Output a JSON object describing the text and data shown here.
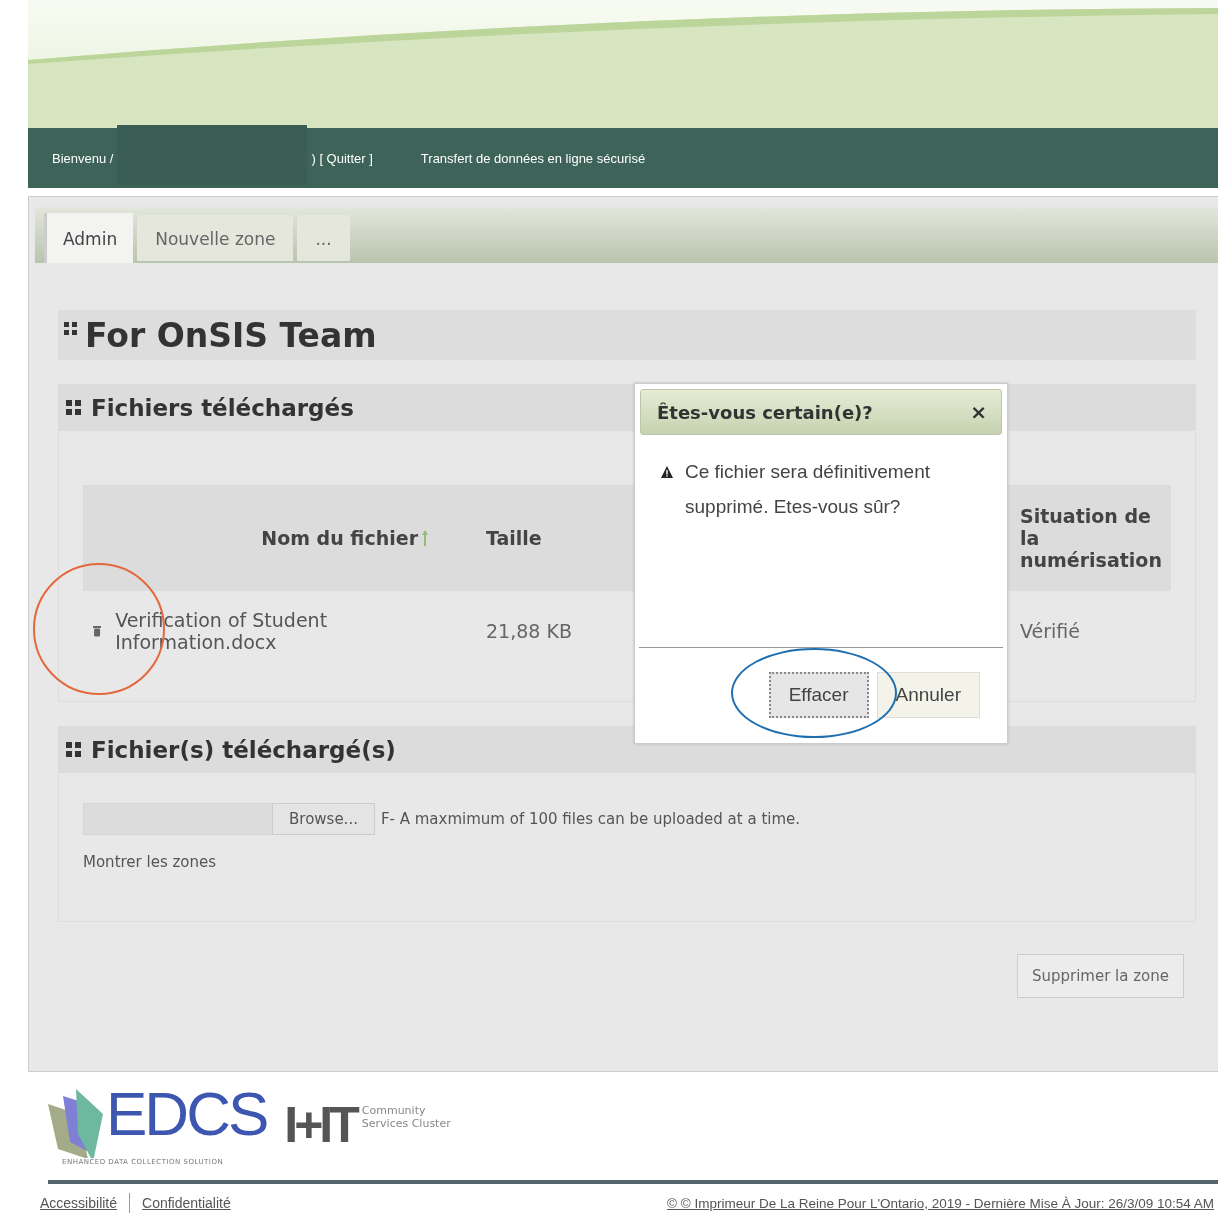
{
  "header": {
    "welcome": "Bienvenu /",
    "quit": ") [ Quitter ]",
    "title": "Transfert de données en ligne sécurisé"
  },
  "tabs": [
    {
      "label": "Admin",
      "selected": true
    },
    {
      "label": "Nouvelle zone",
      "selected": false
    },
    {
      "label": "...",
      "selected": false
    }
  ],
  "page_title": "For OnSIS Team",
  "files_section": {
    "title": "Fichiers téléchargés",
    "columns": [
      "Nom du fichier",
      "Taille",
      "Situation de la numérisation"
    ],
    "rows": [
      {
        "name": "Verification of Student Information.docx",
        "size": "21,88 KB",
        "status": "Vérifié"
      }
    ]
  },
  "upload_section": {
    "title": "Fichier(s) téléchargé(s)",
    "browse": "Browse...",
    "note": "F- A maxmimum of 100 files can be uploaded at a time.",
    "show_zones": "Montrer les zones"
  },
  "delete_zone": "Supprimer la zone",
  "dialog": {
    "title": "Êtes-vous certain(e)?",
    "close": "×",
    "message": "Ce fichier sera définitivement supprimé. Etes-vous sûr?",
    "buttons": [
      {
        "label": "Effacer",
        "selected": true
      },
      {
        "label": "Annuler",
        "selected": false
      }
    ]
  },
  "logo": {
    "name": "EDCS",
    "tagline": "ENHANCED DATA COLLECTION SOLUTION",
    "partner": "I+IT",
    "partner_text": "Community Services Cluster"
  },
  "footer": {
    "links": [
      "Accessibilité",
      "Confidentialité"
    ],
    "copyright": "© © Imprimeur De La Reine Pour L'Ontario, 2019 - Dernière Mise À Jour: 26/3/09 10:54 AM"
  }
}
